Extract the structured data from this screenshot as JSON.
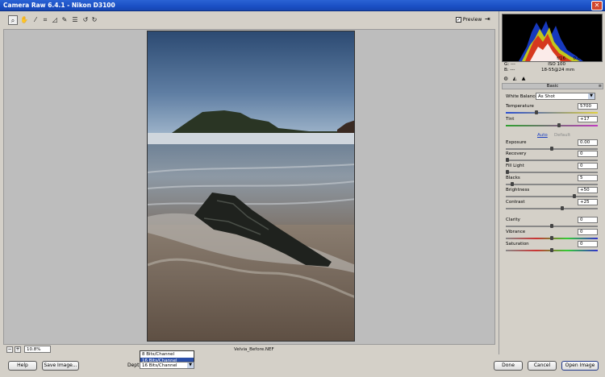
{
  "window": {
    "title": "Camera Raw 6.4.1  -  Nikon D3100",
    "close_label": "✕"
  },
  "toolbar": {
    "preview_label": "Preview",
    "preview_checked": "✓"
  },
  "image": {
    "filename": "Velvia_Before.NEF"
  },
  "status": {
    "zoom": "10.8%",
    "zoom_out": "−",
    "zoom_in": "+"
  },
  "histogram": {
    "r": "R:  ---",
    "g": "G:  ---",
    "b": "B:  ---",
    "aperture": "f/16",
    "shutter": "0.60 s",
    "iso": "ISO 100",
    "lens": "18-55@24 mm"
  },
  "panel": {
    "section": "Basic",
    "white_balance_label": "White Balance:",
    "white_balance_value": "As Shot",
    "auto_label": "Auto",
    "default_label": "Default",
    "controls": [
      {
        "label": "Temperature",
        "value": "5700",
        "level": 0.33
      },
      {
        "label": "Tint",
        "value": "+17",
        "level": 0.58
      },
      {
        "label": "Exposure",
        "value": "0.00",
        "level": 0.5
      },
      {
        "label": "Recovery",
        "value": "0",
        "level": 0.0
      },
      {
        "label": "Fill Light",
        "value": "0",
        "level": 0.0
      },
      {
        "label": "Blacks",
        "value": "5",
        "level": 0.05
      },
      {
        "label": "Brightness",
        "value": "+50",
        "level": 0.75
      },
      {
        "label": "Contrast",
        "value": "+25",
        "level": 0.62
      },
      {
        "label": "Clarity",
        "value": "0",
        "level": 0.5
      },
      {
        "label": "Vibrance",
        "value": "0",
        "level": 0.5
      },
      {
        "label": "Saturation",
        "value": "0",
        "level": 0.5
      }
    ]
  },
  "buttons": {
    "help": "Help",
    "save_image": "Save Image...",
    "done": "Done",
    "cancel": "Cancel",
    "open_image": "Open Image"
  },
  "depth": {
    "label": "Depth:",
    "options": [
      "8 Bits/Channel",
      "16 Bits/Channel",
      "16 Bits/Channel"
    ],
    "selected": "16 Bits/Channel"
  },
  "icons": [
    "zoom-icon",
    "hand-icon",
    "eyedropper-icon",
    "crop-icon",
    "straighten-icon",
    "spot-removal-icon",
    "list-icon",
    "rotate-left-icon",
    "rotate-right-icon",
    "fullscreen-icon"
  ]
}
